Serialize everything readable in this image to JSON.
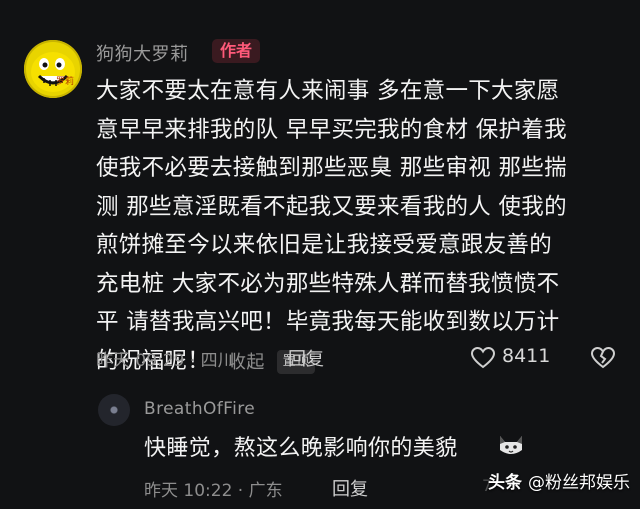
{
  "comment": {
    "author_name": "狗狗大罗莉",
    "author_badge": "作者",
    "avatar_tag": "罗莉",
    "text_lines": [
      "大家不要太在意有人来闹事 多在意一下大家愿",
      "意早早来排我的队 早早买完我的食材 保护着我",
      "使我不必要去接触到那些恶臭 那些审视 那些揣",
      "测 那些意淫既看不起我又要来看我的人 使我的",
      "煎饼摊至今以来依旧是让我接受爱意跟友善的",
      "充电桩 大家不必为那些特殊人群而替我愤愤不",
      "平 请替我高兴吧！毕竟我每天能收到数以万计",
      "的祝福呢！"
    ],
    "collapse_label": "收起",
    "pin_label": "置顶",
    "time_location": "昨天 09:29 · 四川",
    "reply_label": "回复",
    "like_count": "8411"
  },
  "sub_comment": {
    "author_name": "BreathOfFire",
    "text": "快睡觉，熬这么晚影响你的美貌",
    "time_location": "昨天 10:22 · 广东",
    "reply_label": "回复",
    "like_partial": "7"
  },
  "watermark": {
    "brand": "头条",
    "account": "@粉丝邦娱乐"
  },
  "colors": {
    "background": "#111214",
    "badge_text": "#ff5a7a",
    "avatar_yellow": "#e8d400"
  },
  "icons": [
    "heart-icon",
    "broken-heart-icon",
    "cat-emoji-icon"
  ]
}
